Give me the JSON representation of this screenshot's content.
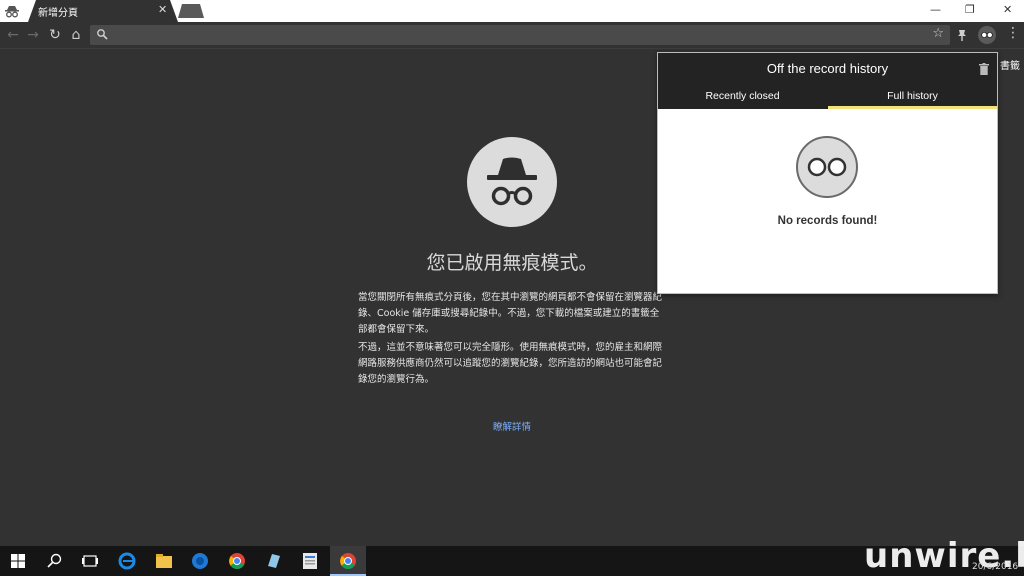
{
  "tab": {
    "title": "新增分頁",
    "close": "✕"
  },
  "window_controls": {
    "minimize": "—",
    "restore": "❐",
    "close": "✕"
  },
  "toolbar": {
    "back": "←",
    "forward": "→",
    "reload": "↻",
    "home": "⌂",
    "star": "☆",
    "menu": "⋮"
  },
  "omnibox": {
    "value": ""
  },
  "bookmarks": {
    "label": "書籤"
  },
  "incognito": {
    "title": "您已啟用無痕模式。",
    "paragraph1": "當您關閉所有無痕式分頁後，您在其中瀏覽的網頁都不會保留在瀏覽器紀錄、Cookie 儲存庫或搜尋紀錄中。不過，您下載的檔案或建立的書籤全部都會保留下來。",
    "paragraph2": "不過，這並不意味著您可以完全隱形。使用無痕模式時，您的雇主和網際網路服務供應商仍然可以追蹤您的瀏覽紀錄，您所造訪的網站也可能會記錄您的瀏覽行為。",
    "learn_more": "瞭解詳情"
  },
  "popup": {
    "title": "Off the record history",
    "tabs": [
      "Recently closed",
      "Full history"
    ],
    "active_tab": 1,
    "empty_message": "No records found!"
  },
  "taskbar": {
    "watermark": "unwire.hk",
    "date_fragment": "20/6/2016"
  },
  "colors": {
    "page_bg": "#323232",
    "popup_header": "#232323",
    "tab_indicator": "#f3e27a",
    "link": "#7cacf8",
    "taskbar": "#151515"
  }
}
